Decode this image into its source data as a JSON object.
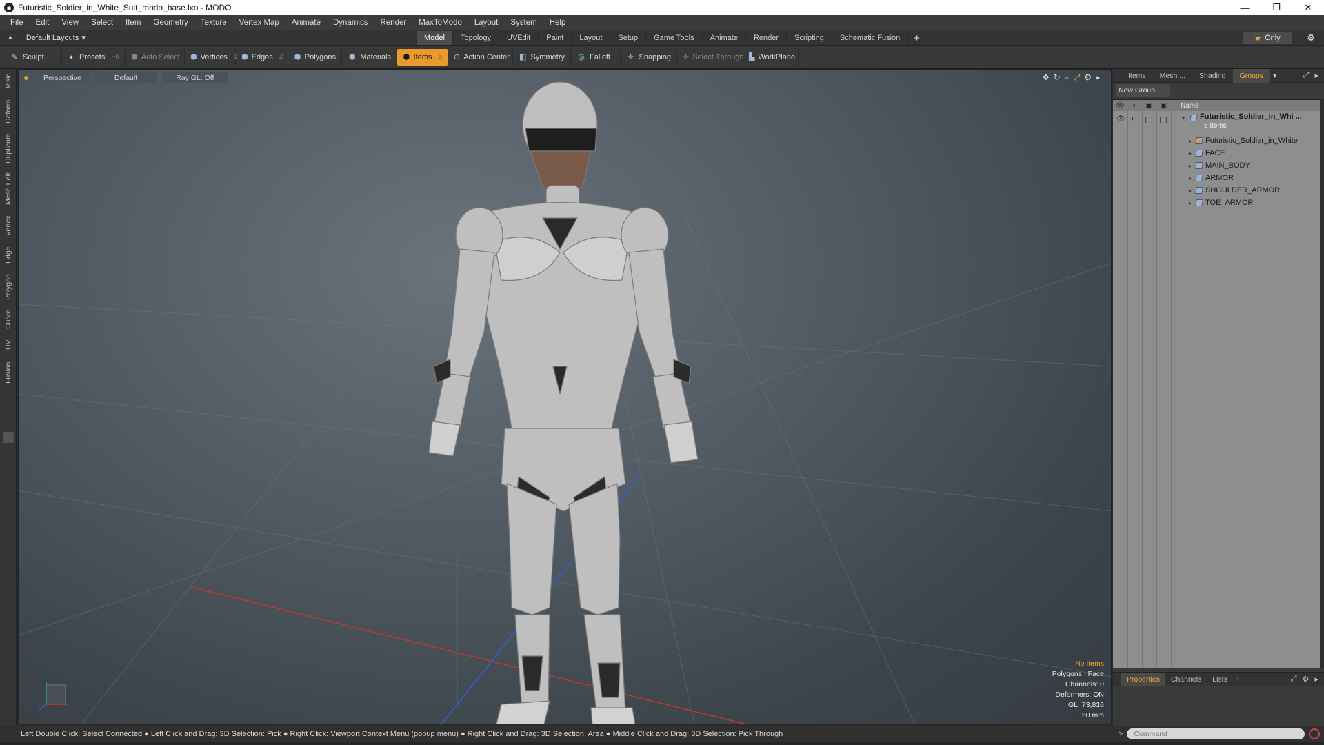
{
  "window": {
    "title": "Futuristic_Soldier_in_White_Suit_modo_base.lxo - MODO",
    "controls": [
      "—",
      "❐",
      "✕"
    ]
  },
  "menu": [
    "File",
    "Edit",
    "View",
    "Select",
    "Item",
    "Geometry",
    "Texture",
    "Vertex Map",
    "Animate",
    "Dynamics",
    "Render",
    "MaxToModo",
    "Layout",
    "System",
    "Help"
  ],
  "layout_bar": {
    "layout_name": "Default Layouts",
    "tabs": [
      "Model",
      "Topology",
      "UVEdit",
      "Paint",
      "Layout",
      "Setup",
      "Game Tools",
      "Animate",
      "Render",
      "Scripting",
      "Schematic Fusion"
    ],
    "active_tab": "Model",
    "only_label": "Only"
  },
  "toolbar": {
    "sculpt": "Sculpt",
    "presets": "Presets",
    "presets_key": "F6",
    "auto_select": "Auto Select",
    "vertices": "Vertices",
    "vertices_count": "1",
    "edges": "Edges",
    "edges_count": "2",
    "polygons": "Polygons",
    "materials": "Materials",
    "items": "Items",
    "items_count": "5",
    "action_center": "Action Center",
    "symmetry": "Symmetry",
    "falloff": "Falloff",
    "snapping": "Snapping",
    "select_through": "Select Through",
    "workplane": "WorkPlane"
  },
  "left_tabs": [
    "Basic",
    "Deform",
    "Duplicate",
    "Mesh Edit",
    "Vertex",
    "Edge",
    "Polygon",
    "Curve",
    "UV",
    "Fusion"
  ],
  "viewport": {
    "view": "Perspective",
    "shading": "Default",
    "raygl": "Ray GL: Off",
    "info": {
      "no_items": "No Items",
      "polygons": "Polygons : Face",
      "channels": "Channels: 0",
      "deformers": "Deformers: ON",
      "gl": "GL: 73,816",
      "scale": "50 mm"
    },
    "colors": {
      "accent": "#e89a2a",
      "x_axis": "#c0392b",
      "y_axis": "#27ae60",
      "z_axis": "#2e5fd8"
    }
  },
  "right_panel": {
    "tabs": [
      "Items",
      "Mesh ...",
      "Shading",
      "Groups"
    ],
    "active_tab": "Groups",
    "new_group": "New Group",
    "column_name": "Name",
    "group": {
      "name": "Futuristic_Soldier_in_Whi ...",
      "count": "6 Items"
    },
    "items": [
      "Futuristic_Soldier_in_White ...",
      "FACE",
      "MAIN_BODY",
      "ARMOR",
      "SHOULDER_ARMOR",
      "TOE_ARMOR"
    ],
    "bottom_tabs": [
      "Properties",
      "Channels",
      "Lists"
    ],
    "bottom_active": "Properties"
  },
  "status": {
    "hint": "Left Double Click: Select Connected ● Left Click and Drag: 3D Selection: Pick ● Right Click: Viewport Context Menu (popup menu) ● Right Click and Drag: 3D Selection: Area ● Middle Click and Drag: 3D Selection: Pick Through",
    "command_placeholder": "Command"
  }
}
